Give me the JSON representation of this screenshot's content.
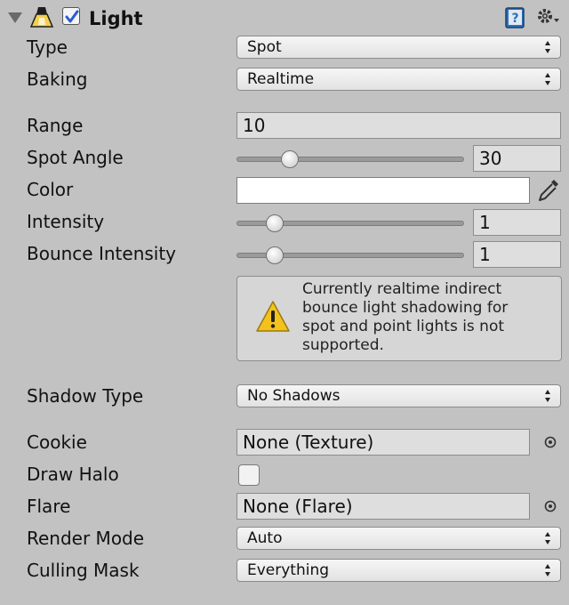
{
  "header": {
    "title": "Light",
    "enabled": true,
    "component_icon": "spotlight-icon",
    "help_icon": "help-book-icon",
    "settings_icon": "gear-dropdown-icon"
  },
  "fields": {
    "type": {
      "label": "Type",
      "value": "Spot"
    },
    "baking": {
      "label": "Baking",
      "value": "Realtime"
    },
    "range": {
      "label": "Range",
      "value": "10"
    },
    "spot_angle": {
      "label": "Spot Angle",
      "value": "30",
      "slider_fraction": 0.2
    },
    "color": {
      "label": "Color",
      "value": "#ffffff",
      "picker_icon": "eyedropper-icon"
    },
    "intensity": {
      "label": "Intensity",
      "value": "1",
      "slider_fraction": 0.125
    },
    "bounce_intensity": {
      "label": "Bounce Intensity",
      "value": "1",
      "slider_fraction": 0.125
    },
    "shadow_type": {
      "label": "Shadow Type",
      "value": "No Shadows"
    },
    "cookie": {
      "label": "Cookie",
      "value": "None (Texture)"
    },
    "draw_halo": {
      "label": "Draw Halo",
      "checked": false
    },
    "flare": {
      "label": "Flare",
      "value": "None (Flare)"
    },
    "render_mode": {
      "label": "Render Mode",
      "value": "Auto"
    },
    "culling_mask": {
      "label": "Culling Mask",
      "value": "Everything"
    }
  },
  "warning": {
    "icon": "warning-triangle-icon",
    "text": "Currently realtime indirect\nbounce light shadowing for\nspot and point lights is not\nsupported."
  }
}
